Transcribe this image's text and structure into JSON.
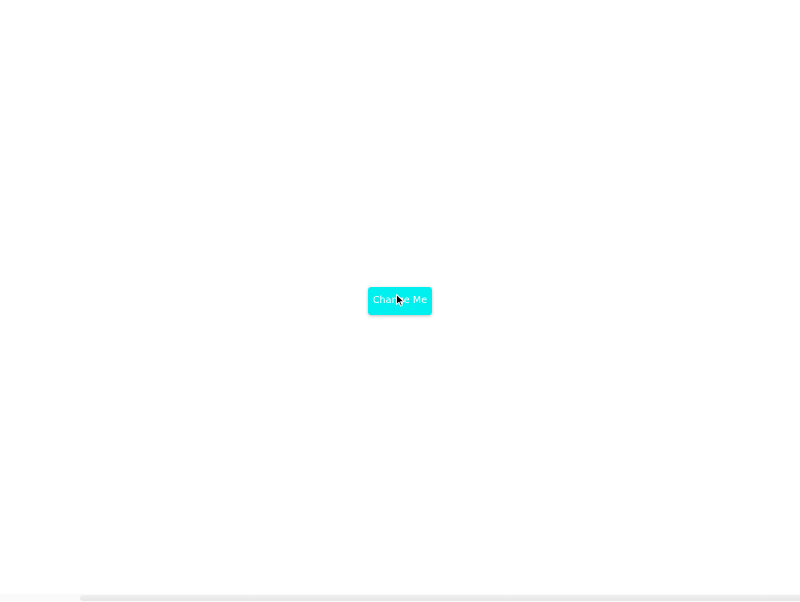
{
  "button": {
    "label": "Change Me",
    "color": "#00f0f0",
    "text_color": "#ffffff"
  },
  "cursor": {
    "icon": "arrow-pointer-icon"
  }
}
